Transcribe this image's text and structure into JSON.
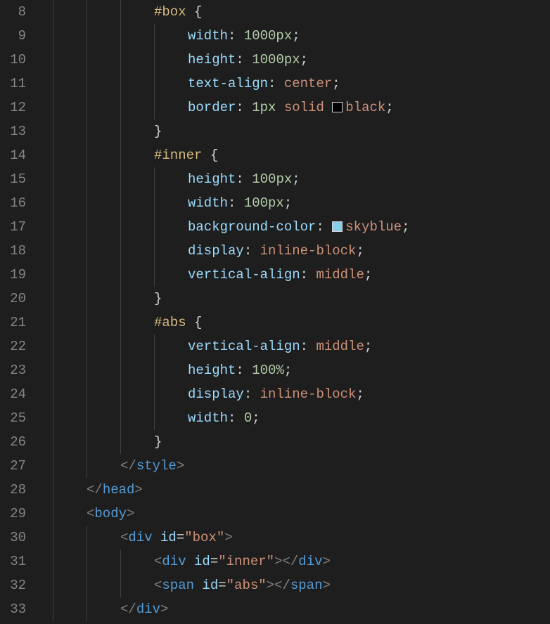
{
  "lines": [
    {
      "num": "8",
      "indent": 3,
      "tokens": [
        [
          "p1",
          "#box"
        ],
        [
          "p3",
          " {"
        ]
      ]
    },
    {
      "num": "9",
      "indent": 4,
      "tokens": [
        [
          "p2",
          "width"
        ],
        [
          "p3",
          ": "
        ],
        [
          "p4",
          "1000px"
        ],
        [
          "p3",
          ";"
        ]
      ]
    },
    {
      "num": "10",
      "indent": 4,
      "tokens": [
        [
          "p2",
          "height"
        ],
        [
          "p3",
          ": "
        ],
        [
          "p4",
          "1000px"
        ],
        [
          "p3",
          ";"
        ]
      ]
    },
    {
      "num": "11",
      "indent": 4,
      "tokens": [
        [
          "p2",
          "text-align"
        ],
        [
          "p3",
          ": "
        ],
        [
          "p5",
          "center"
        ],
        [
          "p3",
          ";"
        ]
      ]
    },
    {
      "num": "12",
      "indent": 4,
      "tokens": [
        [
          "p2",
          "border"
        ],
        [
          "p3",
          ": "
        ],
        [
          "p4",
          "1px"
        ],
        [
          "p3",
          " "
        ],
        [
          "p5",
          "solid"
        ],
        [
          "p3",
          " "
        ],
        [
          "swatch",
          "#000000"
        ],
        [
          "p5",
          "black"
        ],
        [
          "p3",
          ";"
        ]
      ]
    },
    {
      "num": "13",
      "indent": 3,
      "tokens": [
        [
          "p3",
          "}"
        ]
      ]
    },
    {
      "num": "14",
      "indent": 3,
      "tokens": [
        [
          "p1",
          "#inner"
        ],
        [
          "p3",
          " {"
        ]
      ]
    },
    {
      "num": "15",
      "indent": 4,
      "tokens": [
        [
          "p2",
          "height"
        ],
        [
          "p3",
          ": "
        ],
        [
          "p4",
          "100px"
        ],
        [
          "p3",
          ";"
        ]
      ]
    },
    {
      "num": "16",
      "indent": 4,
      "tokens": [
        [
          "p2",
          "width"
        ],
        [
          "p3",
          ": "
        ],
        [
          "p4",
          "100px"
        ],
        [
          "p3",
          ";"
        ]
      ]
    },
    {
      "num": "17",
      "indent": 4,
      "tokens": [
        [
          "p2",
          "background-color"
        ],
        [
          "p3",
          ": "
        ],
        [
          "swatch",
          "#87ceeb"
        ],
        [
          "p5",
          "skyblue"
        ],
        [
          "p3",
          ";"
        ]
      ]
    },
    {
      "num": "18",
      "indent": 4,
      "tokens": [
        [
          "p2",
          "display"
        ],
        [
          "p3",
          ": "
        ],
        [
          "p5",
          "inline-block"
        ],
        [
          "p3",
          ";"
        ]
      ]
    },
    {
      "num": "19",
      "indent": 4,
      "tokens": [
        [
          "p2",
          "vertical-align"
        ],
        [
          "p3",
          ": "
        ],
        [
          "p5",
          "middle"
        ],
        [
          "p3",
          ";"
        ]
      ]
    },
    {
      "num": "20",
      "indent": 3,
      "tokens": [
        [
          "p3",
          "}"
        ]
      ]
    },
    {
      "num": "21",
      "indent": 3,
      "tokens": [
        [
          "p1",
          "#abs"
        ],
        [
          "p3",
          " {"
        ]
      ]
    },
    {
      "num": "22",
      "indent": 4,
      "tokens": [
        [
          "p2",
          "vertical-align"
        ],
        [
          "p3",
          ": "
        ],
        [
          "p5",
          "middle"
        ],
        [
          "p3",
          ";"
        ]
      ]
    },
    {
      "num": "23",
      "indent": 4,
      "tokens": [
        [
          "p2",
          "height"
        ],
        [
          "p3",
          ": "
        ],
        [
          "p4",
          "100%"
        ],
        [
          "p3",
          ";"
        ]
      ]
    },
    {
      "num": "24",
      "indent": 4,
      "tokens": [
        [
          "p2",
          "display"
        ],
        [
          "p3",
          ": "
        ],
        [
          "p5",
          "inline-block"
        ],
        [
          "p3",
          ";"
        ]
      ]
    },
    {
      "num": "25",
      "indent": 4,
      "tokens": [
        [
          "p2",
          "width"
        ],
        [
          "p3",
          ": "
        ],
        [
          "p4",
          "0"
        ],
        [
          "p3",
          ";"
        ]
      ]
    },
    {
      "num": "26",
      "indent": 3,
      "tokens": [
        [
          "p3",
          "}"
        ]
      ]
    },
    {
      "num": "27",
      "indent": 2,
      "tokens": [
        [
          "p6",
          "</"
        ],
        [
          "p7",
          "style"
        ],
        [
          "p6",
          ">"
        ]
      ]
    },
    {
      "num": "28",
      "indent": 1,
      "tokens": [
        [
          "p6",
          "</"
        ],
        [
          "p7",
          "head"
        ],
        [
          "p6",
          ">"
        ]
      ]
    },
    {
      "num": "29",
      "indent": 1,
      "tokens": [
        [
          "p6",
          "<"
        ],
        [
          "p7",
          "body"
        ],
        [
          "p6",
          ">"
        ]
      ]
    },
    {
      "num": "30",
      "indent": 2,
      "tokens": [
        [
          "p6",
          "<"
        ],
        [
          "p7",
          "div"
        ],
        [
          "p3",
          " "
        ],
        [
          "p8",
          "id"
        ],
        [
          "p3",
          "="
        ],
        [
          "p5",
          "\"box\""
        ],
        [
          "p6",
          ">"
        ]
      ]
    },
    {
      "num": "31",
      "indent": 3,
      "tokens": [
        [
          "p6",
          "<"
        ],
        [
          "p7",
          "div"
        ],
        [
          "p3",
          " "
        ],
        [
          "p8",
          "id"
        ],
        [
          "p3",
          "="
        ],
        [
          "p5",
          "\"inner\""
        ],
        [
          "p6",
          "></"
        ],
        [
          "p7",
          "div"
        ],
        [
          "p6",
          ">"
        ]
      ]
    },
    {
      "num": "32",
      "indent": 3,
      "tokens": [
        [
          "p6",
          "<"
        ],
        [
          "p7",
          "span"
        ],
        [
          "p3",
          " "
        ],
        [
          "p8",
          "id"
        ],
        [
          "p3",
          "="
        ],
        [
          "p5",
          "\"abs\""
        ],
        [
          "p6",
          "></"
        ],
        [
          "p7",
          "span"
        ],
        [
          "p6",
          ">"
        ]
      ]
    },
    {
      "num": "33",
      "indent": 2,
      "tokens": [
        [
          "p6",
          "</"
        ],
        [
          "p7",
          "div"
        ],
        [
          "p6",
          ">"
        ]
      ]
    }
  ]
}
